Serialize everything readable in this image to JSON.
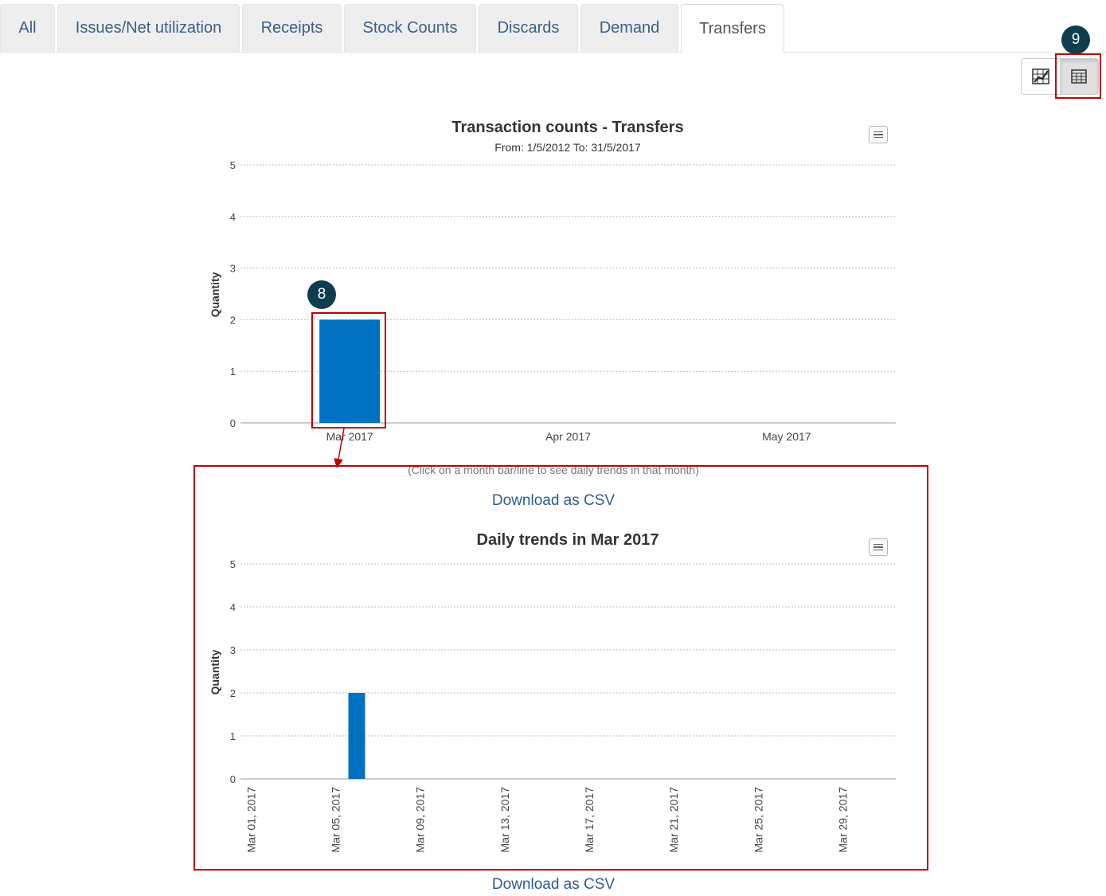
{
  "tabs": [
    {
      "label": "All",
      "active": false
    },
    {
      "label": "Issues/Net utilization",
      "active": false
    },
    {
      "label": "Receipts",
      "active": false
    },
    {
      "label": "Stock Counts",
      "active": false
    },
    {
      "label": "Discards",
      "active": false
    },
    {
      "label": "Demand",
      "active": false
    },
    {
      "label": "Transfers",
      "active": true
    }
  ],
  "view_toggle": {
    "chart_icon": "chart-icon",
    "table_icon": "table-icon",
    "active": "table"
  },
  "callouts": {
    "badge_8": "8",
    "badge_9": "9",
    "color_badge": "#0f3d4f",
    "color_box": "#c00000"
  },
  "monthly_chart": {
    "title": "Transaction counts - Transfers",
    "subtitle": "From: 1/5/2012 To: 31/5/2017",
    "hint": "(Click on a month bar/line to see daily trends in that month)",
    "download_label": "Download as CSV",
    "menu_icon": "hamburger-menu-icon"
  },
  "daily_chart": {
    "title": "Daily trends in Mar 2017",
    "download_label": "Download as CSV",
    "menu_icon": "hamburger-menu-icon"
  },
  "colors": {
    "bar": "#0070c0",
    "tab_text": "#3a5f86",
    "link": "#2f5d8c"
  },
  "chart_data": [
    {
      "type": "bar",
      "title": "Transaction counts - Transfers",
      "subtitle": "From: 1/5/2012 To: 31/5/2017",
      "categories": [
        "Mar 2017",
        "Apr 2017",
        "May 2017"
      ],
      "values": [
        2,
        0,
        0
      ],
      "xlabel": "",
      "ylabel": "Quantity",
      "ylim": [
        0,
        5
      ],
      "yticks": [
        0,
        1,
        2,
        3,
        4,
        5
      ],
      "grid": true,
      "legend": "none"
    },
    {
      "type": "bar",
      "title": "Daily trends in Mar 2017",
      "x_tick_labels": [
        "Mar 01, 2017",
        "Mar 05, 2017",
        "Mar 09, 2017",
        "Mar 13, 2017",
        "Mar 17, 2017",
        "Mar 21, 2017",
        "Mar 25, 2017",
        "Mar 29, 2017"
      ],
      "x_range": [
        "Mar 01, 2017",
        "Mar 31, 2017"
      ],
      "bars": [
        {
          "x": "Mar 06, 2017",
          "value": 2
        }
      ],
      "xlabel": "",
      "ylabel": "Quantity",
      "ylim": [
        0,
        5
      ],
      "yticks": [
        0,
        1,
        2,
        3,
        4,
        5
      ],
      "grid": true,
      "legend": "none"
    }
  ]
}
